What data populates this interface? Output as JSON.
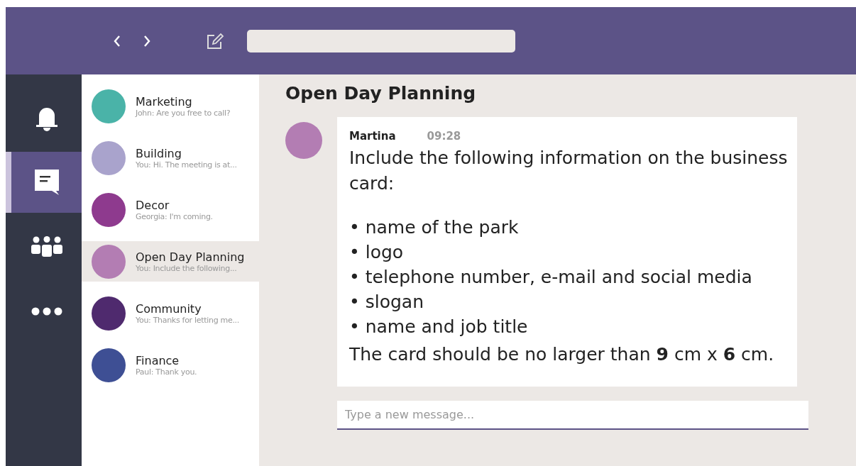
{
  "rail": [
    {
      "selected": false
    },
    {
      "selected": true
    },
    {
      "selected": false
    },
    {
      "selected": false
    }
  ],
  "chats": [
    {
      "name": "Marketing",
      "preview": "John: Are you free to call?",
      "color": "#4ab3a8",
      "selected": false
    },
    {
      "name": "Building",
      "preview": "You: Hi. The meeting is at...",
      "color": "#a9a3cc",
      "selected": false
    },
    {
      "name": "Decor",
      "preview": "Georgia: I'm coming.",
      "color": "#8e3a8e",
      "selected": false
    },
    {
      "name": "Open Day Planning",
      "preview": "You: Include the following...",
      "color": "#b37db3",
      "selected": true
    },
    {
      "name": "Community",
      "preview": "You: Thanks for letting me...",
      "color": "#4f2a6e",
      "selected": false
    },
    {
      "name": "Finance",
      "preview": "Paul: Thank you.",
      "color": "#3e4f94",
      "selected": false
    }
  ],
  "conversation": {
    "title": "Open Day Planning",
    "message": {
      "author": "Martina",
      "time": "09:28",
      "intro": "Include the following information on the business card:",
      "bullets": [
        "name of the park",
        "logo",
        "telephone number, e-mail and social media",
        "slogan",
        "name and job title"
      ],
      "bullet_mark": "•",
      "closing": "The card should be no larger than **9** cm x **6** cm."
    },
    "compose": {
      "placeholder": "Type a new message..."
    }
  }
}
